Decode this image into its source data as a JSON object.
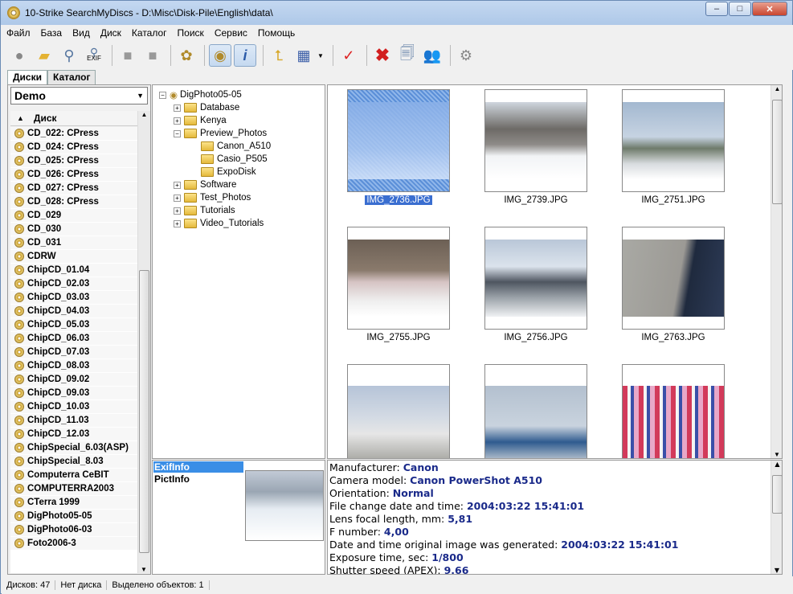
{
  "window": {
    "title": "10-Strike SearchMyDiscs - D:\\Misc\\Disk-Pile\\English\\data\\",
    "min": "–",
    "max": "□",
    "close": "✕"
  },
  "menu": [
    "Файл",
    "База",
    "Вид",
    "Диск",
    "Каталог",
    "Поиск",
    "Сервис",
    "Помощь"
  ],
  "toolbar": {
    "exif_label": "EXIF"
  },
  "tabs": [
    "Диски",
    "Каталог"
  ],
  "left": {
    "dropdown": "Demo",
    "column_header": "Диск",
    "disks": [
      "CD_022: CPress",
      "CD_024: CPress",
      "CD_025: CPress",
      "CD_026: CPress",
      "CD_027: CPress",
      "CD_028: CPress",
      "CD_029",
      "CD_030",
      "CD_031",
      "CDRW",
      "ChipCD_01.04",
      "ChipCD_02.03",
      "ChipCD_03.03",
      "ChipCD_04.03",
      "ChipCD_05.03",
      "ChipCD_06.03",
      "ChipCD_07.03",
      "ChipCD_08.03",
      "ChipCD_09.02",
      "ChipCD_09.03",
      "ChipCD_10.03",
      "ChipCD_11.03",
      "ChipCD_12.03",
      "ChipSpecial_6.03(ASP)",
      "ChipSpecial_8.03",
      "Computerra CeBIT",
      "COMPUTERRA2003",
      "CTerra 1999",
      "DigPhoto05-05",
      "DigPhoto06-03",
      "Foto2006-3"
    ]
  },
  "tree": {
    "root": "DigPhoto05-05",
    "nodes": [
      "Database",
      "Kenya",
      "Preview_Photos",
      "Canon_A510",
      "Casio_P505",
      "ExpoDisk",
      "Software",
      "Test_Photos",
      "Tutorials",
      "Video_Tutorials"
    ]
  },
  "thumbnails": [
    "IMG_2736.JPG",
    "IMG_2739.JPG",
    "IMG_2751.JPG",
    "IMG_2755.JPG",
    "IMG_2756.JPG",
    "IMG_2763.JPG"
  ],
  "info_nav": [
    "ExifInfo",
    "PictInfo"
  ],
  "exif": [
    {
      "k": "Manufacturer: ",
      "v": "Canon"
    },
    {
      "k": "Camera model: ",
      "v": "Canon PowerShot A510"
    },
    {
      "k": "Orientation: ",
      "v": "Normal"
    },
    {
      "k": "File change date and time: ",
      "v": "2004:03:22 15:41:01"
    },
    {
      "k": "Lens focal length, mm: ",
      "v": "5,81"
    },
    {
      "k": "F number: ",
      "v": "4,00"
    },
    {
      "k": "Date and time original image was generated: ",
      "v": "2004:03:22 15:41:01"
    },
    {
      "k": "Exposure time, sec: ",
      "v": "1/800"
    },
    {
      "k": "Shutter speed (APEX): ",
      "v": "9,66"
    }
  ],
  "status": [
    "Дисков: 47",
    "Нет диска",
    "Выделено объектов: 1"
  ]
}
